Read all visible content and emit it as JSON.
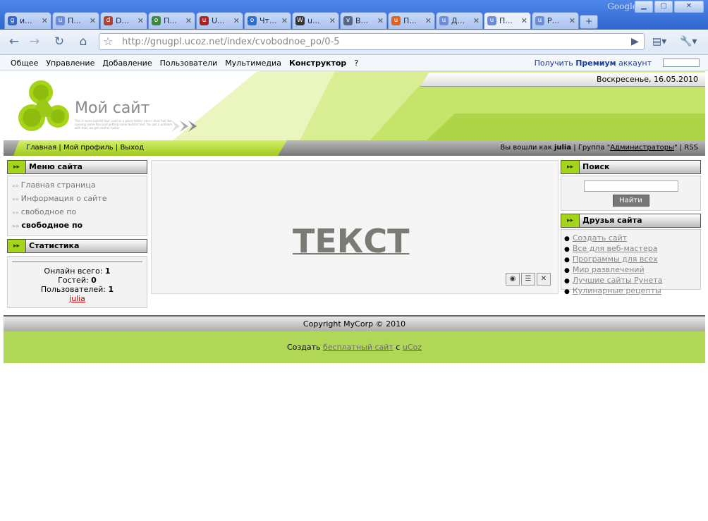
{
  "browser": {
    "brand": "Google",
    "tabs": [
      {
        "label": "и...",
        "fav_color": "#3366cc",
        "fav": "g"
      },
      {
        "label": "П...",
        "fav_color": "#6b8cd6",
        "fav": "u"
      },
      {
        "label": "D...",
        "fav_color": "#b04030",
        "fav": "d"
      },
      {
        "label": "П...",
        "fav_color": "#3a8a3a",
        "fav": "o"
      },
      {
        "label": "U...",
        "fav_color": "#aa2222",
        "fav": "u"
      },
      {
        "label": "Чт...",
        "fav_color": "#2a6fd0",
        "fav": "o"
      },
      {
        "label": "u...",
        "fav_color": "#333333",
        "fav": "W"
      },
      {
        "label": "В...",
        "fav_color": "#556688",
        "fav": "v"
      },
      {
        "label": "П...",
        "fav_color": "#e06020",
        "fav": "u"
      },
      {
        "label": "Д...",
        "fav_color": "#6b8cd6",
        "fav": "u"
      },
      {
        "label": "П...",
        "fav_color": "#6b8cd6",
        "fav": "u"
      },
      {
        "label": "Р...",
        "fav_color": "#6b8cd6",
        "fav": "u"
      }
    ],
    "active_tab": 10,
    "url_domain": "http://gnugpl.ucoz.net",
    "url_path": "/index/cvobodnoe_po/0-5"
  },
  "ucoz_panel": {
    "menu": [
      "Общее",
      "Управление",
      "Добавление",
      "Пользователи",
      "Мультимедиа"
    ],
    "menu_bold": "Конструктор",
    "help": "?",
    "premium_prefix": "Получить ",
    "premium_bold": "Премиум",
    "premium_suffix": " аккаунт"
  },
  "site": {
    "date": "Воскресенье, 16.05.2010",
    "title": "Мой сайт",
    "subtitle": "This is some bullshit text used as a place holder since I dont feel like opening some files and getting some bullshit text. You get a problem with that, we got mother fucker",
    "nav": {
      "home": "Главная",
      "profile": "Мой профиль",
      "logout": "Выход",
      "login_prefix": "Вы вошли как ",
      "user": "julia",
      "group_prefix": " | Группа \"",
      "group": "Администраторы",
      "group_suffix": "\" | RSS"
    },
    "menu_title": "Меню сайта",
    "menu_items": [
      "Главная страница",
      "Информация о сайте",
      "свободное по"
    ],
    "menu_current": "свободное по",
    "stats_title": "Статистика",
    "stats": {
      "online_label": "Онлайн всего: ",
      "online": "1",
      "guests_label": "Гостей: ",
      "guests": "0",
      "users_label": "Пользователей: ",
      "users": "1",
      "user_link": "julia"
    },
    "content_text": "ТЕКСТ",
    "search_title": "Поиск",
    "search_button": "Найти",
    "friends_title": "Друзья сайта",
    "friends": [
      "Создать сайт",
      "Все для веб-мастера",
      "Программы для всех",
      "Мир развлечений",
      "Лучшие сайты Рунета",
      "Кулинарные рецепты"
    ],
    "copyright": "Copyright MyCorp © 2010",
    "footer_prefix": "Создать ",
    "footer_link1": "бесплатный сайт",
    "footer_mid": " с ",
    "footer_link2": "uCoz"
  }
}
